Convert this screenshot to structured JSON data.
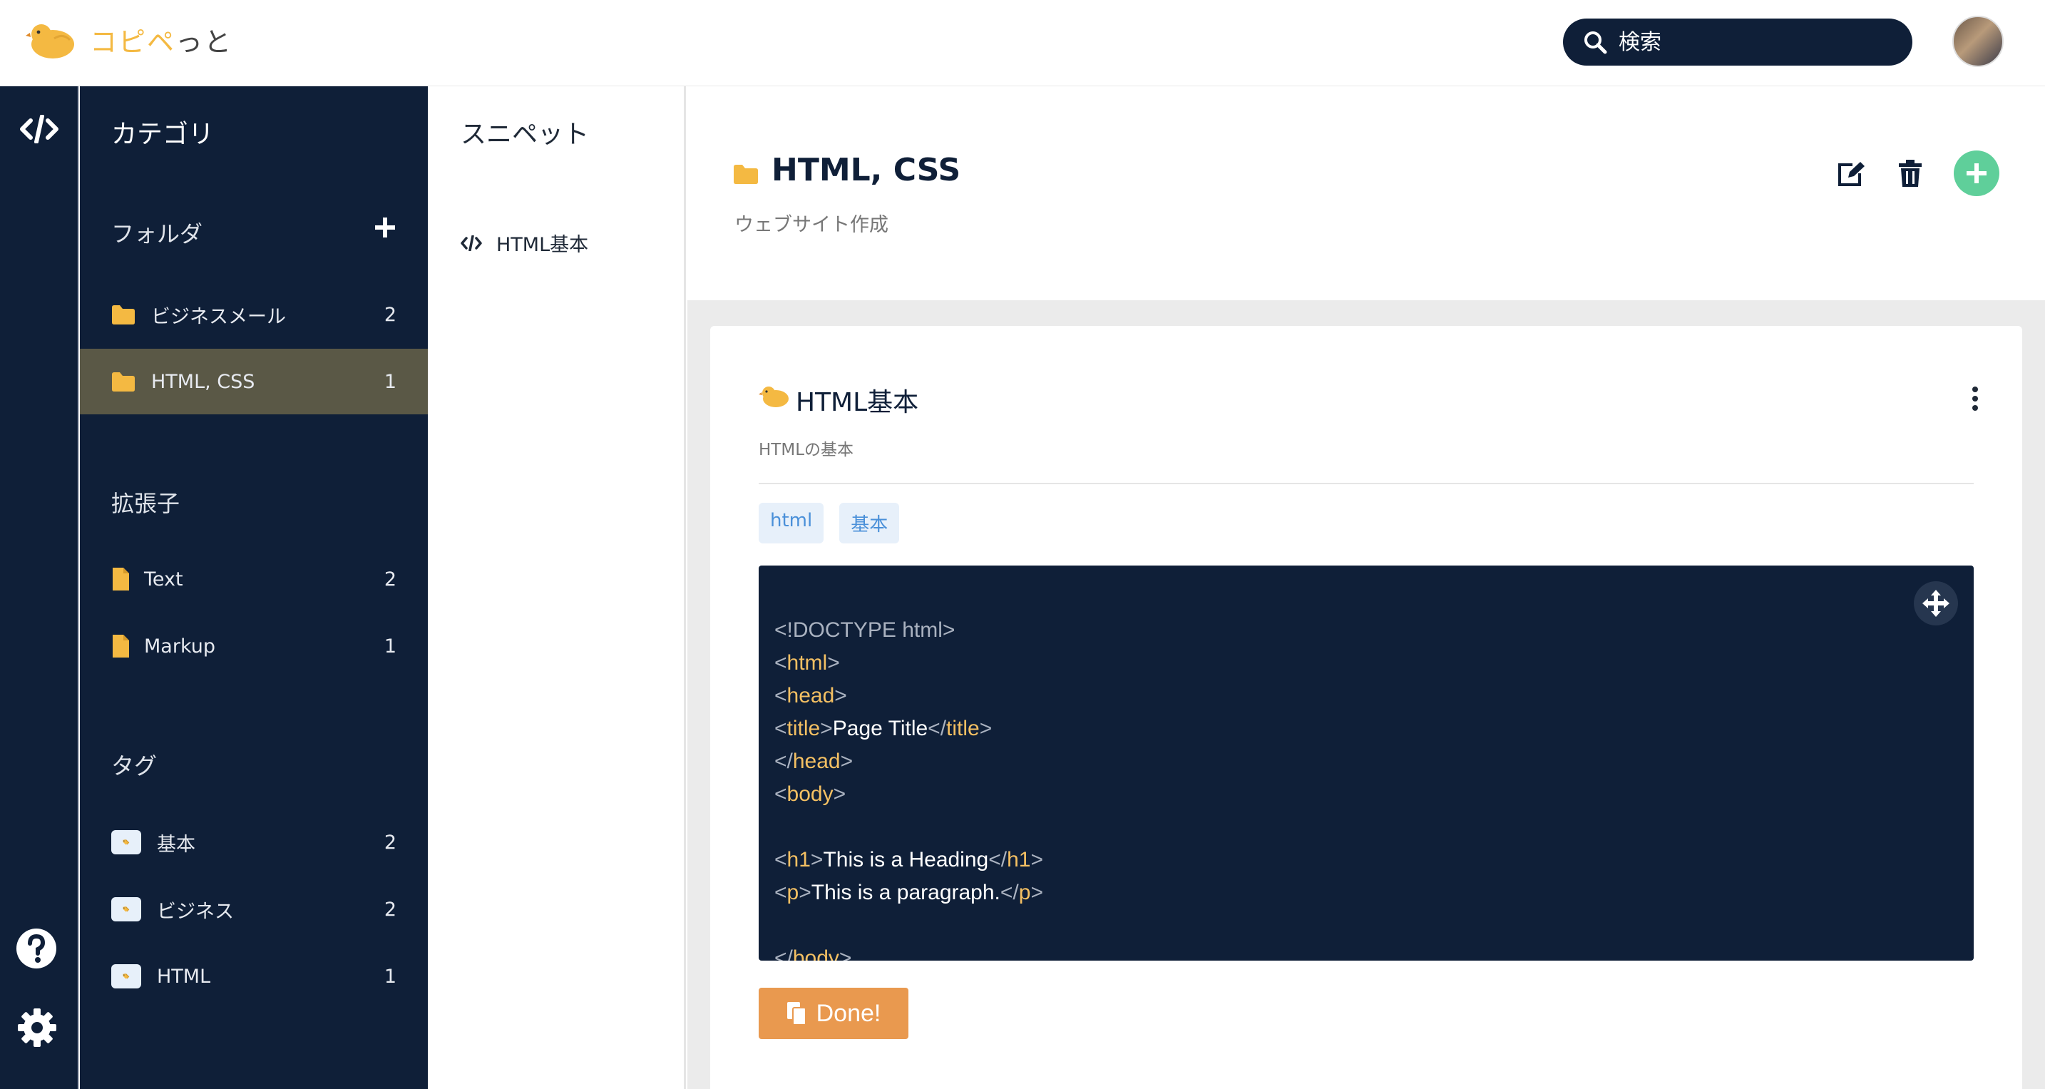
{
  "app": {
    "logo_accent": "コピペ",
    "logo_rest": "っと"
  },
  "search": {
    "placeholder": "検索"
  },
  "sidebar": {
    "title": "カテゴリ",
    "folders": {
      "heading": "フォルダ",
      "items": [
        {
          "label": "ビジネスメール",
          "count": "2"
        },
        {
          "label": "HTML, CSS",
          "count": "1",
          "active": true
        }
      ]
    },
    "extensions": {
      "heading": "拡張子",
      "items": [
        {
          "label": "Text",
          "count": "2"
        },
        {
          "label": "Markup",
          "count": "1"
        }
      ]
    },
    "tags": {
      "heading": "タグ",
      "items": [
        {
          "label": "基本",
          "count": "2"
        },
        {
          "label": "ビジネス",
          "count": "2"
        },
        {
          "label": "HTML",
          "count": "1"
        }
      ]
    }
  },
  "snippets": {
    "title": "スニペット",
    "items": [
      {
        "label": "HTML基本"
      }
    ]
  },
  "main": {
    "folder_title": "HTML, CSS",
    "folder_subtitle": "ウェブサイト作成",
    "snippet": {
      "title": "HTML基本",
      "subtitle": "HTMLの基本",
      "tags": [
        "html",
        "基本"
      ],
      "code": {
        "doctype": "<!DOCTYPE html>",
        "title_text": "Page Title",
        "h1_text": "This is a Heading",
        "p_text": "This is a paragraph."
      },
      "copy_button": "Done!"
    }
  },
  "colors": {
    "navy": "#0f1f38",
    "accent_yellow": "#f4b942",
    "active_item": "#5a5846",
    "add_green": "#5fcf9a",
    "copy_orange": "#e9994f",
    "tag_blue": "#4a90d9"
  },
  "icons": {
    "logo": "bird-icon",
    "search": "search-icon",
    "rail": [
      "code-icon",
      "help-icon",
      "gear-icon"
    ],
    "folder": "folder-icon",
    "file": "file-icon",
    "tag": "tags-icon",
    "edit": "edit-icon",
    "trash": "trash-icon",
    "add": "plus-icon",
    "menu": "kebab-menu-icon",
    "move": "move-icon",
    "copy": "copy-icon"
  }
}
